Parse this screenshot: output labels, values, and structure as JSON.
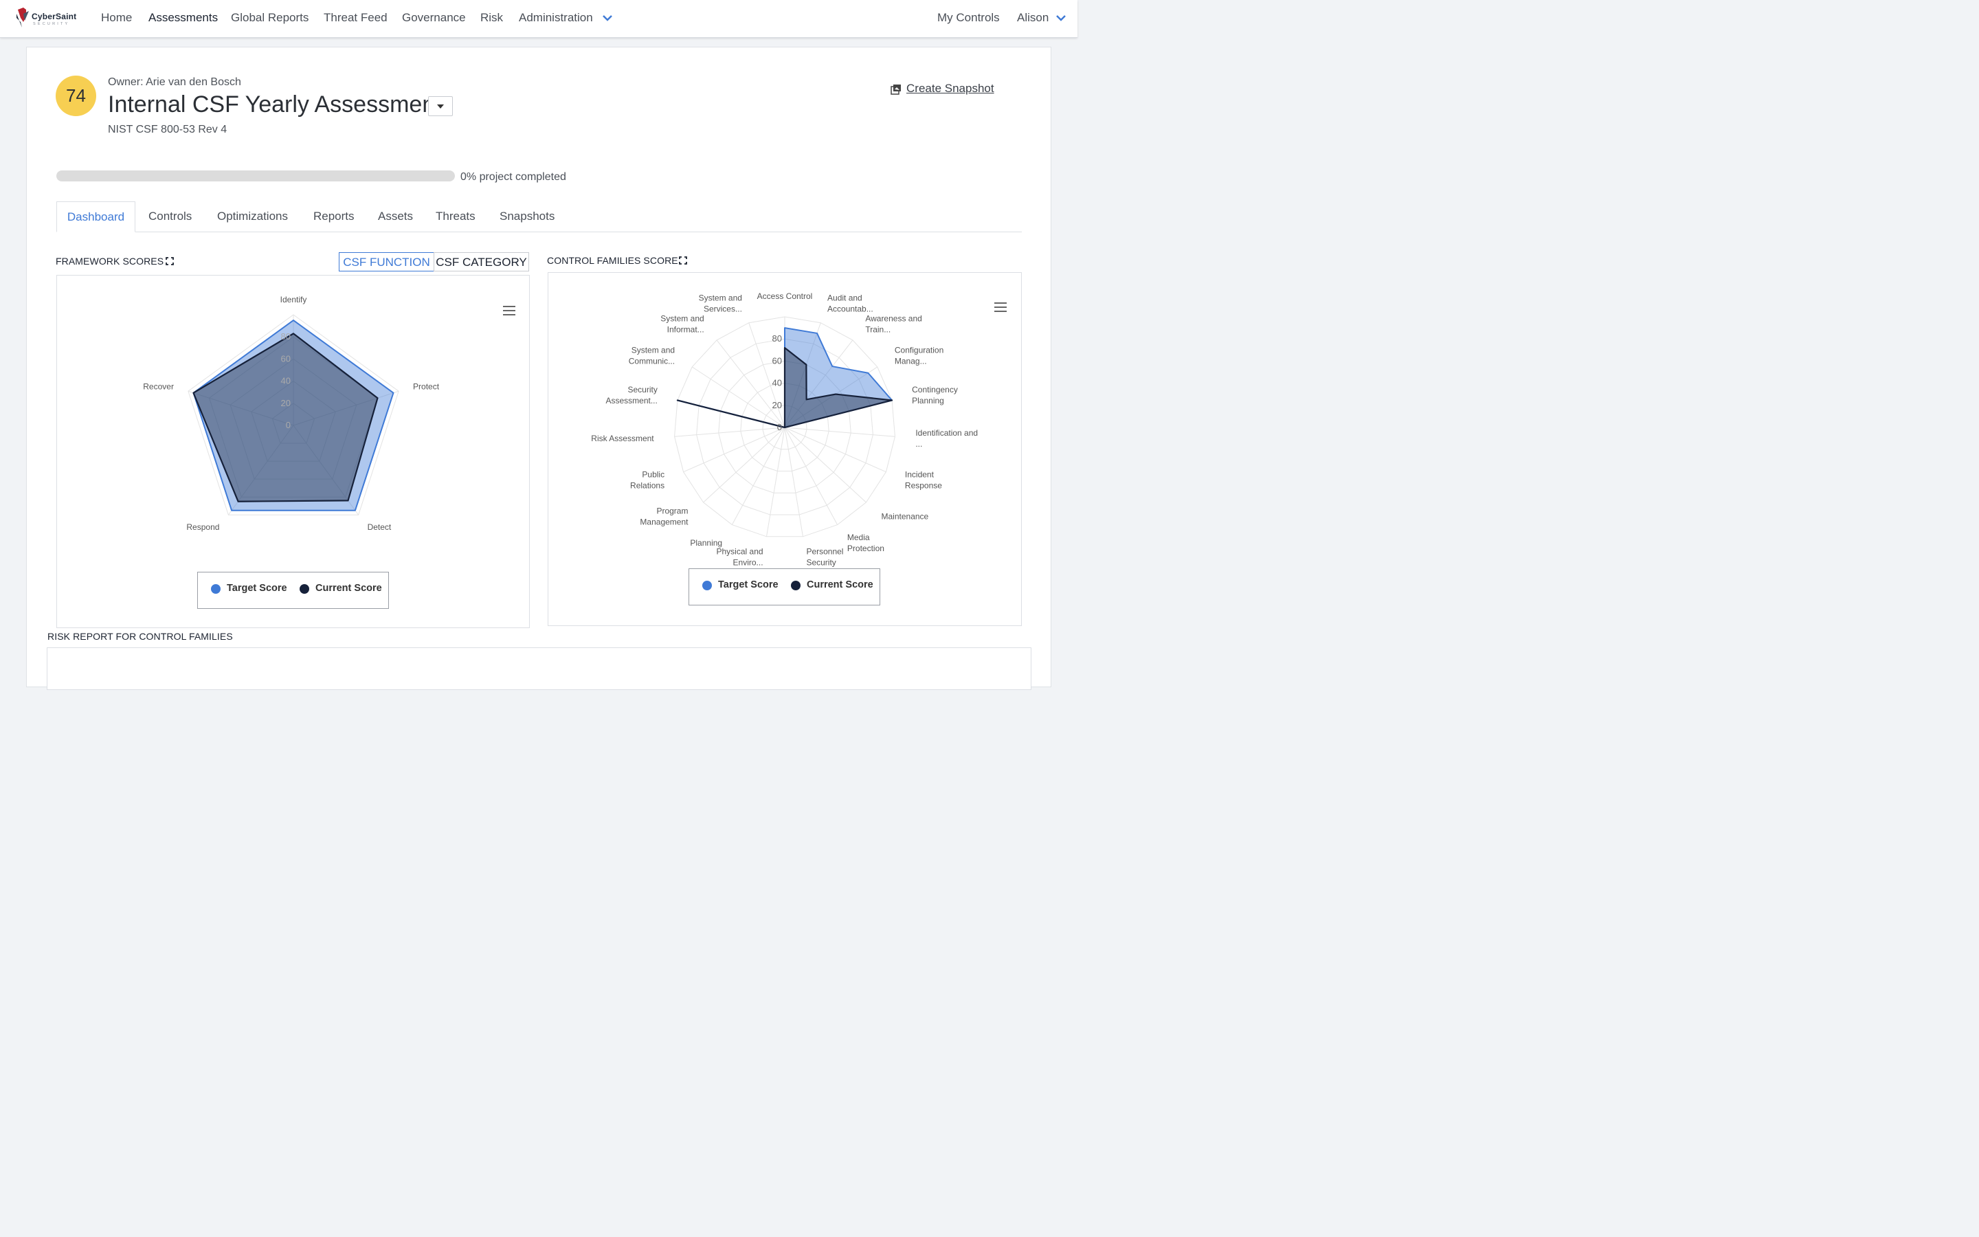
{
  "app": {
    "brand": "CyberSaint",
    "brand_sub": "SECURITY"
  },
  "nav": {
    "items": [
      "Home",
      "Assessments",
      "Global Reports",
      "Threat Feed",
      "Governance",
      "Risk",
      "Administration"
    ],
    "active": "Assessments",
    "right": {
      "my_controls": "My Controls",
      "user": "Alison"
    }
  },
  "assessment": {
    "score": "74",
    "owner": "Owner: Arie van den Bosch",
    "title": "Internal CSF Yearly Assessment",
    "framework": "NIST CSF 800-53 Rev 4",
    "create_snapshot": "Create Snapshot",
    "progress_fraction": 0.0,
    "progress_label": "0% project completed"
  },
  "tabs": [
    "Dashboard",
    "Controls",
    "Optimizations",
    "Reports",
    "Assets",
    "Threats",
    "Snapshots"
  ],
  "active_tab": "Dashboard",
  "framework_scores": {
    "title": "FRAMEWORK SCORES",
    "toggle": {
      "on": "CSF FUNCTION",
      "off": "CSF CATEGORY"
    }
  },
  "control_families": {
    "title": "CONTROL FAMILIES SCORE"
  },
  "risk_report": {
    "title": "RISK REPORT FOR CONTROL FAMILIES"
  },
  "legend": {
    "target": "Target Score",
    "current": "Current Score"
  },
  "colors": {
    "target": "#3f7ad6",
    "current": "#16213a",
    "score_badge": "#f7cf52",
    "accent": "#3f7ad6"
  },
  "chart_data": [
    {
      "type": "radar",
      "categories": [
        "Identify",
        "Protect",
        "Detect",
        "Respond",
        "Recover"
      ],
      "series": [
        {
          "name": "Target Score",
          "values": [
            95,
            95,
            95,
            95,
            95
          ]
        },
        {
          "name": "Current Score",
          "values": [
            83,
            80,
            84,
            85,
            95
          ]
        }
      ],
      "radial_ticks": [
        "0",
        "20",
        "40",
        "60",
        "80"
      ],
      "rmax": 100,
      "legend": "bottom"
    },
    {
      "type": "radar",
      "categories": [
        "Access Control",
        "Audit and Accountab...",
        "Awareness and Train...",
        "Configuration Manag...",
        "Contingency Planning",
        "Identification and ...",
        "Incident Response",
        "Maintenance",
        "Media Protection",
        "Personnel Security",
        "Physical and Enviro...",
        "Planning",
        "Program Management",
        "Public Relations",
        "Risk Assessment",
        "Security Assessment...",
        "System and Communic...",
        "System and Informat...",
        "System and Services..."
      ],
      "series": [
        {
          "name": "Target Score",
          "values": [
            90,
            90,
            70,
            90,
            100,
            0,
            0,
            0,
            0,
            0,
            0,
            0,
            0,
            0,
            0,
            100,
            0,
            0,
            0
          ]
        },
        {
          "name": "Current Score",
          "values": [
            72,
            60,
            32,
            55,
            100,
            0,
            0,
            0,
            0,
            0,
            0,
            0,
            0,
            0,
            0,
            100,
            0,
            0,
            0
          ]
        }
      ],
      "radial_ticks": [
        "0",
        "20",
        "40",
        "60",
        "80"
      ],
      "rmax": 100,
      "legend": "bottom"
    }
  ]
}
